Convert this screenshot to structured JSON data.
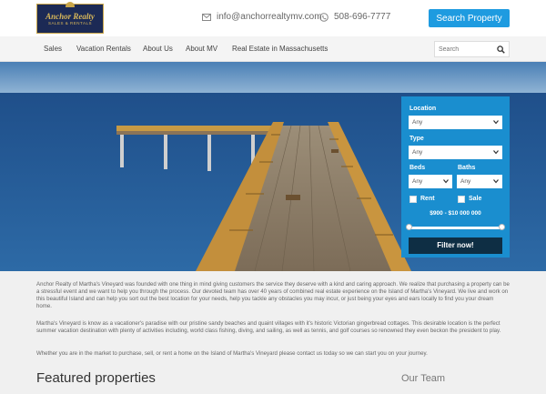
{
  "header": {
    "logo": {
      "main": "Anchor Realty",
      "sub": "SALES & RENTALS"
    },
    "email": "info@anchorrealtymv.com",
    "phone": "508-696-7777",
    "search_button": "Search Property"
  },
  "nav": {
    "items": [
      "Sales",
      "Vacation Rentals",
      "About Us",
      "About MV",
      "Real Estate in Massachusetts"
    ],
    "search_placeholder": "Search"
  },
  "filter": {
    "location_label": "Location",
    "location_value": "Any",
    "type_label": "Type",
    "type_value": "Any",
    "beds_label": "Beds",
    "beds_value": "Any",
    "baths_label": "Baths",
    "baths_value": "Any",
    "rent_label": "Rent",
    "sale_label": "Sale",
    "price_range": "$900 - $10 000 000",
    "submit": "Filter now!"
  },
  "content": {
    "p1": "Anchor Realty of Martha's Vineyard was founded with one thing in mind giving customers the service they deserve with a kind and caring approach. We realize that purchasing a property can be a stressful event and we want to help you through the process. Our devoted team has over 40 years of combined real estate experience on the Island of Martha's Vineyard. We live and work on this beautiful Island and can help you sort out the best location for your needs, help you tackle any obstacles you may incur, or just being your eyes and ears locally to find you your dream home.",
    "p2": "Martha's Vineyard is know as a vacationer's paradise with our pristine sandy beaches and quaint villages with it's historic Victorian gingerbread cottages. This desirable location is the perfect summer vacation destination with plenty of activities including, world class fishing, diving, and sailing, as well as tennis, and golf courses so renowned they even beckon the president to play.",
    "p3": "Whether you are in the market to purchase, sell, or rent a home on the Island of Martha's Vineyard please contact us today so we can start you on your journey.",
    "featured_title": "Featured properties",
    "team_title": "Our Team"
  },
  "colors": {
    "accent": "#1e9be0",
    "panel": "#1a8ecf",
    "button_dark": "#0e2e44",
    "logo_navy": "#1c2a55",
    "logo_gold": "#d9b85a"
  }
}
